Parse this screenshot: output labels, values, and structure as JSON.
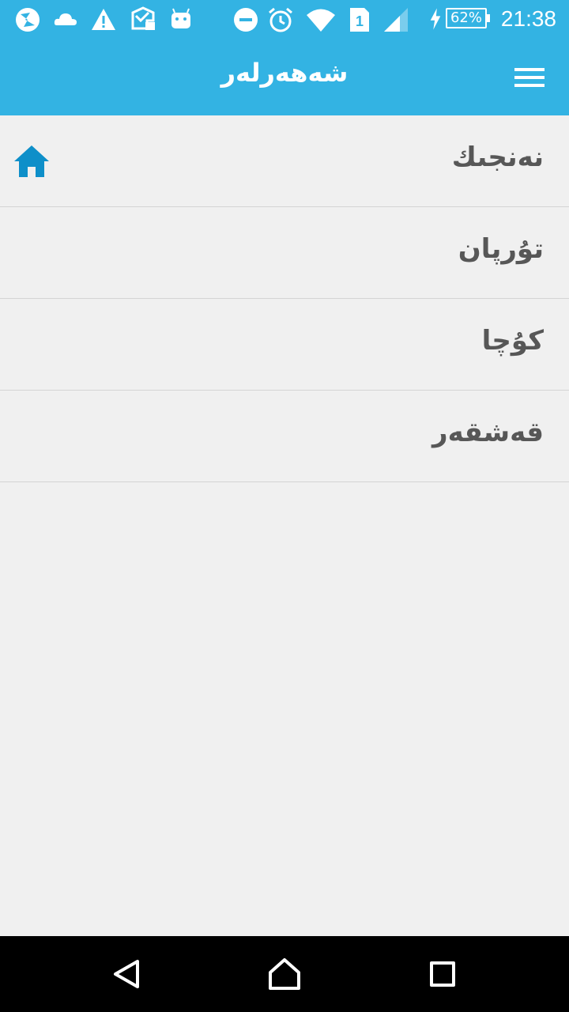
{
  "status_bar": {
    "left_icons": [
      "browser-icon",
      "cloud-icon",
      "warning-icon",
      "message-icon",
      "android-icon"
    ],
    "right_icons": [
      "do-not-disturb-icon",
      "alarm-icon",
      "wifi-icon",
      "sim-1-icon",
      "signal-icon",
      "charging-icon"
    ],
    "battery": "62%",
    "time": "21:38"
  },
  "app_bar": {
    "title": "شەھەرلەر",
    "menu_icon": "menu-icon"
  },
  "list": {
    "items": [
      {
        "label": "نەنجىك",
        "icon": "home-icon",
        "selected": true
      },
      {
        "label": "تۇرپان"
      },
      {
        "label": "كۇچا"
      },
      {
        "label": "قەشقەر"
      }
    ]
  },
  "colors": {
    "accent": "#33b3e3",
    "home_icon": "#0e8fc9",
    "list_text": "#575757",
    "background": "#f0f0f0"
  },
  "nav_bar": {
    "buttons": [
      "back-icon",
      "home-nav-icon",
      "recents-icon"
    ]
  }
}
